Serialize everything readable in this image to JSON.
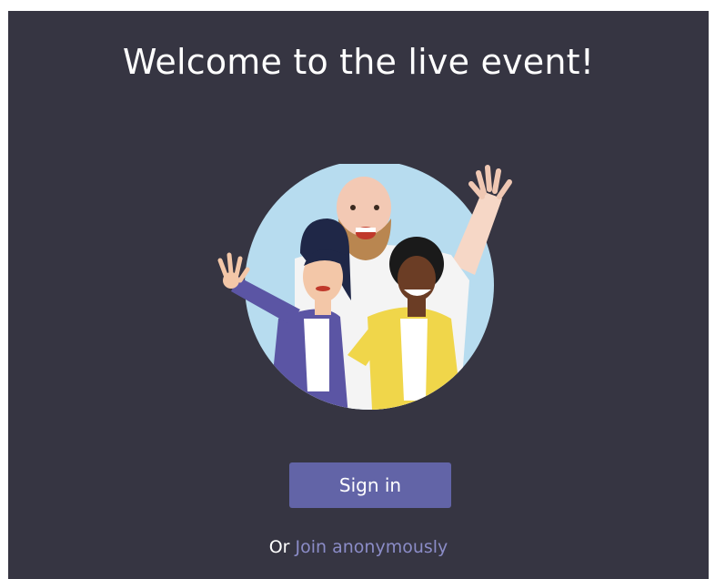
{
  "welcome": {
    "title": "Welcome to the live event!"
  },
  "actions": {
    "sign_in_label": "Sign in",
    "or_label": "Or",
    "join_anonymously_label": "Join anonymously"
  },
  "illustration": {
    "subject": "three-waving-people"
  },
  "colors": {
    "background": "#363542",
    "accent": "#6264a7",
    "link": "#8b8cc7",
    "circle": "#b7dcef"
  }
}
